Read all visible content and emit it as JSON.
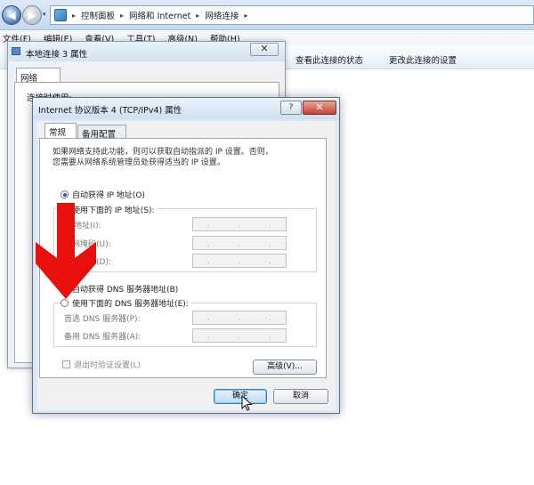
{
  "explorer": {
    "nav_back": "◀",
    "nav_forward": "▶",
    "nav_dropdown": "▾",
    "breadcrumb": [
      "控制面板",
      "网络和 Internet",
      "网络连接"
    ],
    "breadcrumb_sep": "▸",
    "menu": [
      "文件(F)",
      "编辑(E)",
      "查看(V)",
      "工具(T)",
      "高级(N)",
      "帮助(H)"
    ],
    "commands": [
      "查看此连接的状态",
      "更改此连接的设置"
    ]
  },
  "connection_dialog": {
    "title": "本地连接 3 属性",
    "close": "✕",
    "tab": "网络",
    "label": "连接时使用:"
  },
  "ipv4_dialog": {
    "title": "Internet 协议版本 4 (TCP/IPv4) 属性",
    "help": "?",
    "close": "✕",
    "tabs": [
      "常规",
      "备用配置"
    ],
    "description_line1": "如果网络支持此功能，则可以获取自动指派的 IP 设置。否则，",
    "description_line2": "您需要从网络系统管理员处获得适当的 IP 设置。",
    "ip_auto_label": "自动获得 IP 地址(O)",
    "ip_manual_label": "使用下面的 IP 地址(S):",
    "ip_fields": [
      "IP 地址(I):",
      "子网掩码(U):",
      "默认网关(D):"
    ],
    "dns_auto_label": "自动获得 DNS 服务器地址(B)",
    "dns_manual_label": "使用下面的 DNS 服务器地址(E):",
    "dns_fields": [
      "首选 DNS 服务器(P):",
      "备用 DNS 服务器(A):"
    ],
    "ip_dots": ".",
    "validate_label": "退出时验证设置(L)",
    "advanced_button": "高级(V)...",
    "ok_button": "确定",
    "cancel_button": "取消",
    "selected_ip_mode": "auto",
    "selected_dns_mode": "auto"
  },
  "colors": {
    "annotation_arrow": "#e8100c",
    "ok_button": "#b9dbf3",
    "close_button": "#c4442f"
  },
  "icons": {
    "cursor": "mouse-pointer-icon",
    "annotation": "red-arrow-down-icon"
  }
}
